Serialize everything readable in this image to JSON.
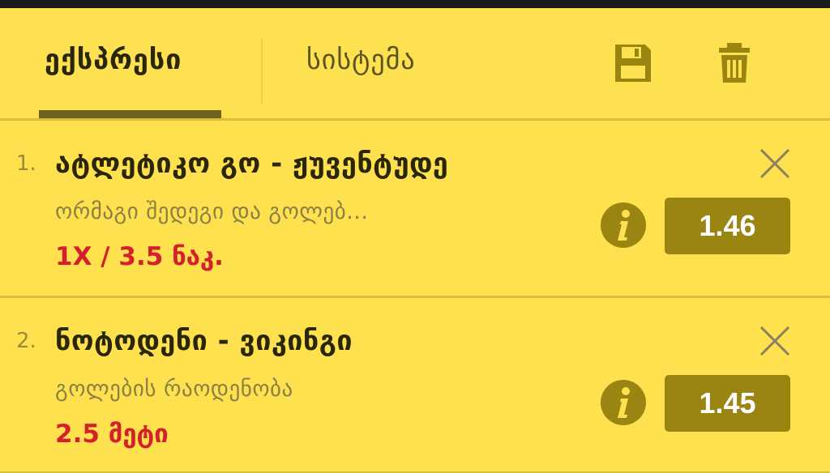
{
  "tabs": {
    "active": "ექსპრესი",
    "inactive": "სისტემა"
  },
  "icons": {
    "save": "save-icon",
    "trash": "trash-icon",
    "close": "close-icon",
    "info": "info-icon"
  },
  "colors": {
    "background": "#ffe14f",
    "odds_button": "#9a8513",
    "pick_text": "#d3202b",
    "active_tab_underline": "#6f641e"
  },
  "bets": [
    {
      "number": "1.",
      "title": "ატლეტიკო გო - ჟუვენტუდე",
      "market": "ორმაგი შედეგი და გოლებ...",
      "pick": "1X / 3.5 ნაკ.",
      "odds": "1.46"
    },
    {
      "number": "2.",
      "title": "ნოტოდენი - ვიკინგი",
      "market": "გოლების რაოდენობა",
      "pick": "2.5 მეტი",
      "odds": "1.45"
    }
  ]
}
